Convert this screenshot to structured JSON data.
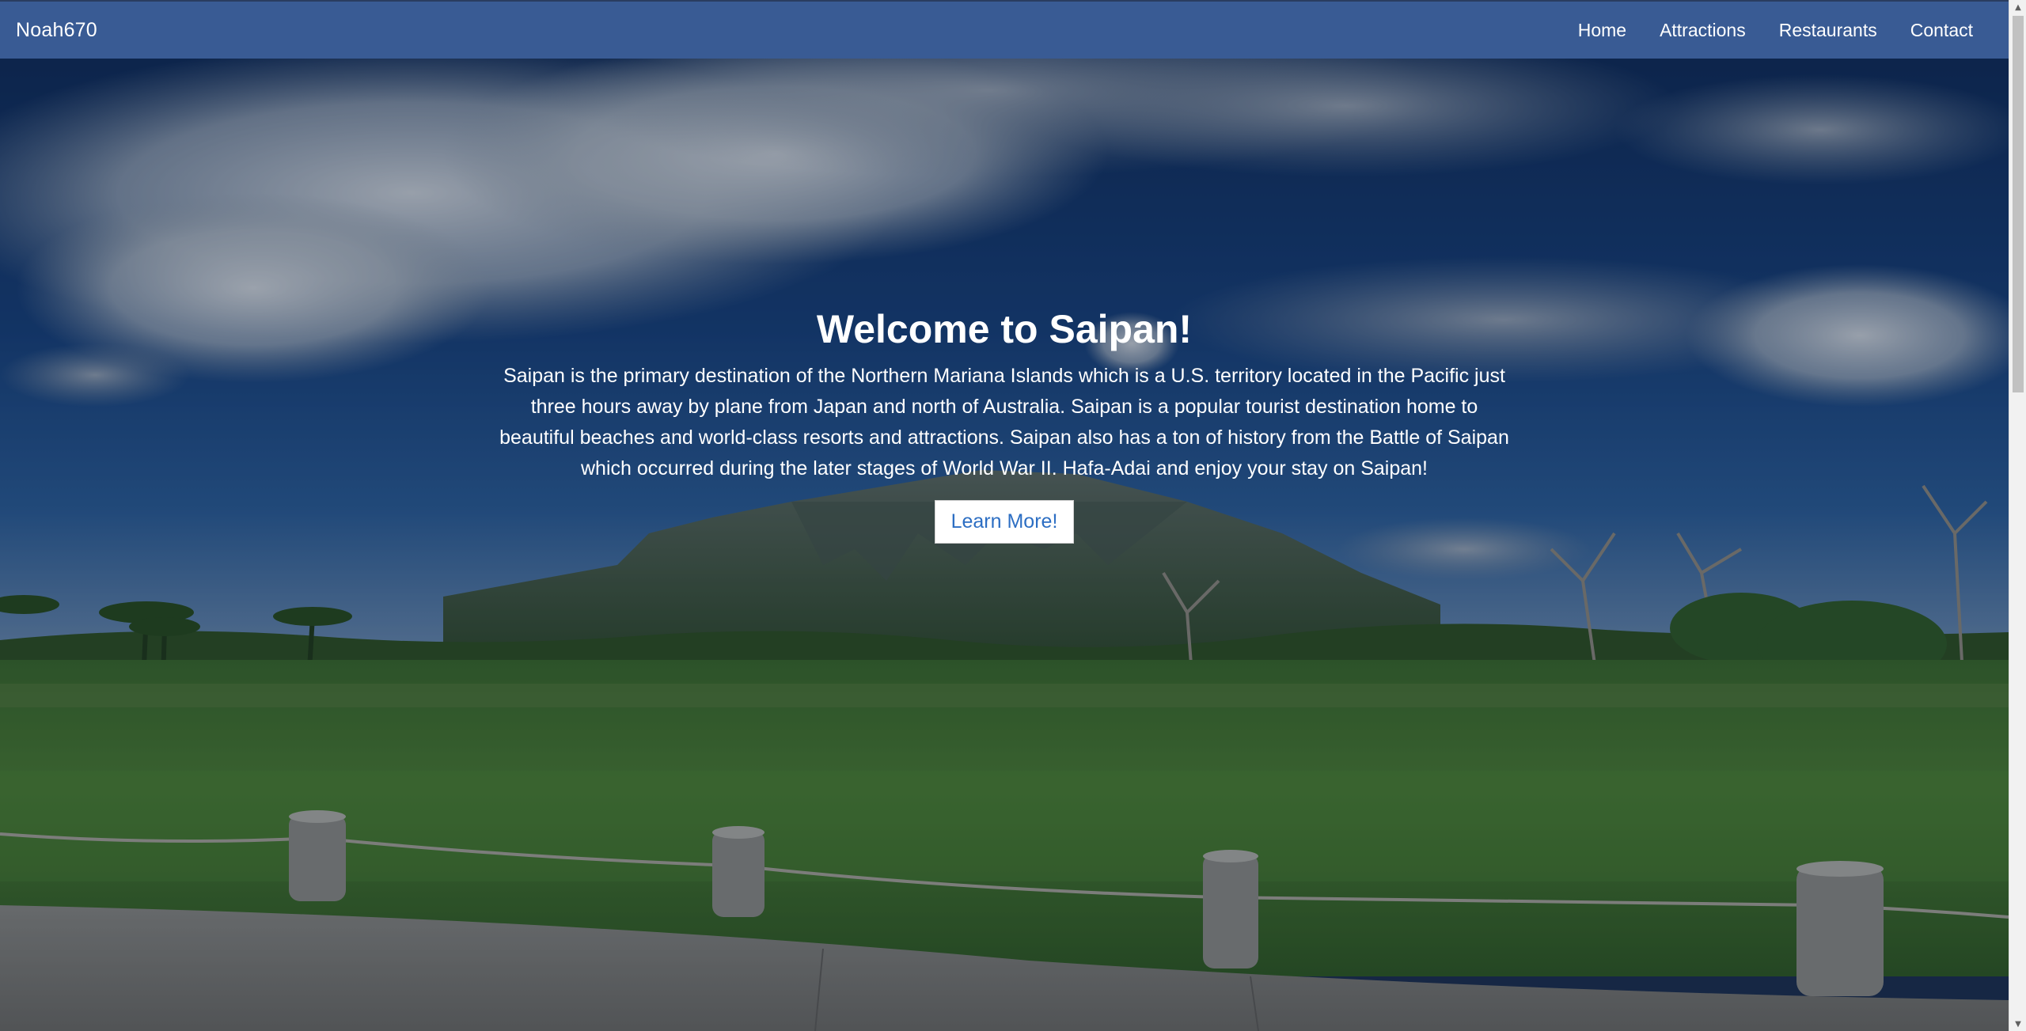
{
  "navbar": {
    "brand": "Noah670",
    "links": [
      {
        "label": "Home"
      },
      {
        "label": "Attractions"
      },
      {
        "label": "Restaurants"
      },
      {
        "label": "Contact"
      }
    ],
    "background_color": "#395b94"
  },
  "hero": {
    "title": "Welcome to Saipan!",
    "description": "Saipan is the primary destination of the Northern Mariana Islands which is a U.S. territory located in the Pacific just three hours away by plane from Japan and north of Australia. Saipan is a popular tourist destination home to beautiful beaches and world-class resorts and attractions. Saipan also has a ton of history from the Battle of Saipan which occurred during the later stages of World War II. Hafa-Adai and enjoy your stay on Saipan!",
    "button_label": "Learn More!",
    "button_text_color": "#2c6ec3"
  }
}
